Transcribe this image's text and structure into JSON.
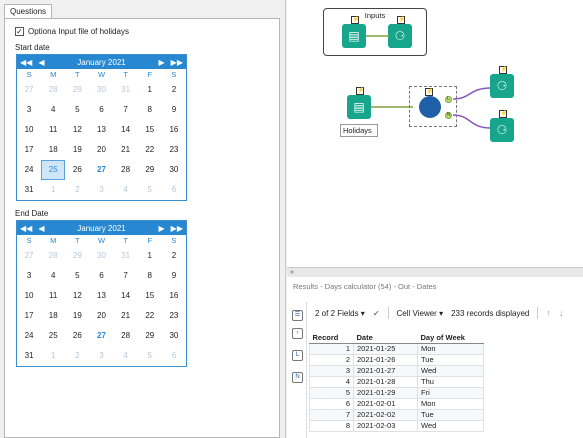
{
  "questions": {
    "tab_label": "Questions",
    "checkbox_label": "Optiona Input file of holidays",
    "checkbox_checked": true,
    "start_label": "Start date",
    "end_label": "End Date"
  },
  "calendar": {
    "title": "January 2021",
    "dow": [
      "S",
      "M",
      "T",
      "W",
      "T",
      "F",
      "S"
    ],
    "weeks": [
      [
        "27",
        "28",
        "29",
        "30",
        "31",
        "1",
        "2"
      ],
      [
        "3",
        "4",
        "5",
        "6",
        "7",
        "8",
        "9"
      ],
      [
        "10",
        "11",
        "12",
        "13",
        "14",
        "15",
        "16"
      ],
      [
        "17",
        "18",
        "19",
        "20",
        "21",
        "22",
        "23"
      ],
      [
        "24",
        "25",
        "26",
        "27",
        "28",
        "29",
        "30"
      ],
      [
        "31",
        "1",
        "2",
        "3",
        "4",
        "5",
        "6"
      ]
    ]
  },
  "canvas": {
    "container_title": "Inputs",
    "annotation": "Holidays"
  },
  "results": {
    "collapse_label": "«",
    "title": "Results - Days calculator (54) - Out - Dates",
    "fields_label": "2 of 2 Fields",
    "viewer_label": "Cell Viewer",
    "records_label": "233 records displayed",
    "columns": [
      "Record",
      "Date",
      "Day of Week"
    ],
    "rows": [
      [
        "1",
        "2021-01-25",
        "Mon"
      ],
      [
        "2",
        "2021-01-26",
        "Tue"
      ],
      [
        "3",
        "2021-01-27",
        "Wed"
      ],
      [
        "4",
        "2021-01-28",
        "Thu"
      ],
      [
        "5",
        "2021-01-29",
        "Fri"
      ],
      [
        "6",
        "2021-02-01",
        "Mon"
      ],
      [
        "7",
        "2021-02-02",
        "Tue"
      ],
      [
        "8",
        "2021-02-03",
        "Wed"
      ]
    ]
  },
  "colors": {
    "accent": "#2788d1",
    "tool": "#17a58b",
    "node": "#1f5fa8"
  }
}
